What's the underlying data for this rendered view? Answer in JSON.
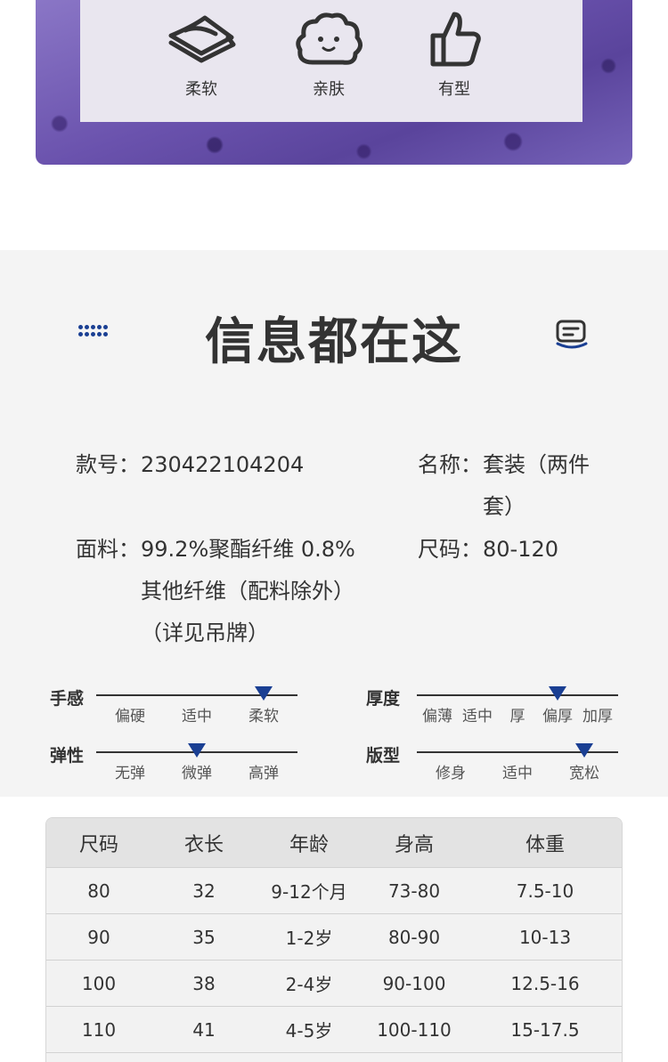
{
  "features": [
    {
      "icon": "layered-fabric-icon",
      "label": "柔软"
    },
    {
      "icon": "cloud-face-icon",
      "label": "亲肤"
    },
    {
      "icon": "thumbs-up-icon",
      "label": "有型"
    }
  ],
  "info": {
    "title": "信息都在这",
    "code_label": "款号：",
    "code_value": "230422104204",
    "name_label": "名称：",
    "name_value": "套装（两件套）",
    "fabric_label": "面料：",
    "fabric_value": "99.2%聚酯纤维 0.8%其他纤维（配料除外）（详见吊牌）",
    "size_label": "尺码：",
    "size_value": "80-120"
  },
  "attributes": {
    "hand_feel": {
      "label": "手感",
      "options": [
        "偏硬",
        "适中",
        "柔软"
      ],
      "selected": "柔软"
    },
    "elasticity": {
      "label": "弹性",
      "options": [
        "无弹",
        "微弹",
        "高弹"
      ],
      "selected": "微弹"
    },
    "thickness": {
      "label": "厚度",
      "options": [
        "偏薄",
        "适中",
        "厚",
        "偏厚",
        "加厚"
      ],
      "selected": "偏厚"
    },
    "fit": {
      "label": "版型",
      "options": [
        "修身",
        "适中",
        "宽松"
      ],
      "selected": "宽松"
    }
  },
  "size_table": {
    "headers": [
      "尺码",
      "衣长",
      "年龄",
      "身高",
      "体重"
    ],
    "rows": [
      [
        "80",
        "32",
        "9-12个月",
        "73-80",
        "7.5-10"
      ],
      [
        "90",
        "35",
        "1-2岁",
        "80-90",
        "10-13"
      ],
      [
        "100",
        "38",
        "2-4岁",
        "90-100",
        "12.5-16"
      ],
      [
        "110",
        "41",
        "4-5岁",
        "100-110",
        "15-17.5"
      ]
    ]
  },
  "colors": {
    "accent": "#1a3f93",
    "banner": "#6a52ad"
  }
}
